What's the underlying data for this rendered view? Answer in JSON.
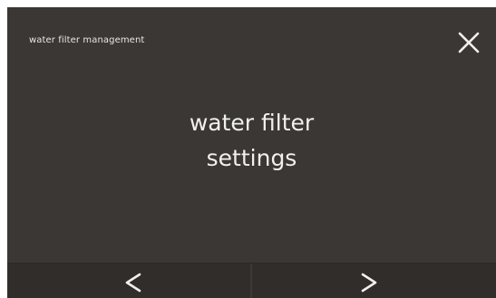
{
  "header": {
    "title": "water filter management",
    "close_icon": "close-icon"
  },
  "main": {
    "label_line1": "water filter",
    "label_line2": "settings"
  },
  "footer": {
    "prev_icon": "chevron-left-icon",
    "next_icon": "chevron-right-icon"
  },
  "colors": {
    "background": "#3a3734",
    "footer_background": "#302d2a",
    "text": "#f1f0ec"
  }
}
